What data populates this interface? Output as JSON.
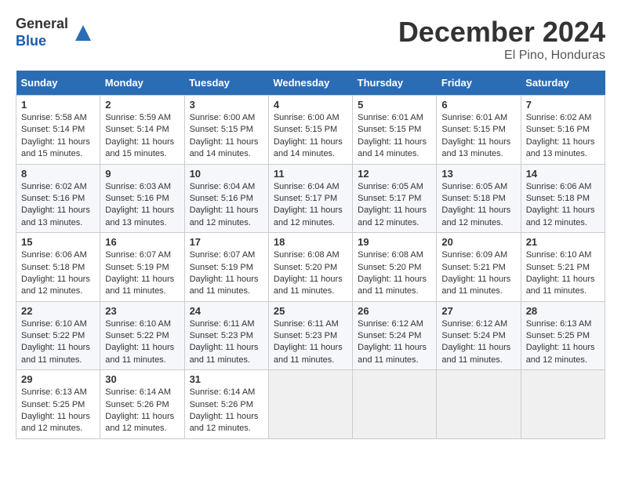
{
  "header": {
    "logo_line1": "General",
    "logo_line2": "Blue",
    "month_title": "December 2024",
    "location": "El Pino, Honduras"
  },
  "days_of_week": [
    "Sunday",
    "Monday",
    "Tuesday",
    "Wednesday",
    "Thursday",
    "Friday",
    "Saturday"
  ],
  "weeks": [
    [
      {
        "day": 1,
        "sunrise": "5:58 AM",
        "sunset": "5:14 PM",
        "daylight": "11 hours and 15 minutes."
      },
      {
        "day": 2,
        "sunrise": "5:59 AM",
        "sunset": "5:14 PM",
        "daylight": "11 hours and 15 minutes."
      },
      {
        "day": 3,
        "sunrise": "6:00 AM",
        "sunset": "5:15 PM",
        "daylight": "11 hours and 14 minutes."
      },
      {
        "day": 4,
        "sunrise": "6:00 AM",
        "sunset": "5:15 PM",
        "daylight": "11 hours and 14 minutes."
      },
      {
        "day": 5,
        "sunrise": "6:01 AM",
        "sunset": "5:15 PM",
        "daylight": "11 hours and 14 minutes."
      },
      {
        "day": 6,
        "sunrise": "6:01 AM",
        "sunset": "5:15 PM",
        "daylight": "11 hours and 13 minutes."
      },
      {
        "day": 7,
        "sunrise": "6:02 AM",
        "sunset": "5:16 PM",
        "daylight": "11 hours and 13 minutes."
      }
    ],
    [
      {
        "day": 8,
        "sunrise": "6:02 AM",
        "sunset": "5:16 PM",
        "daylight": "11 hours and 13 minutes."
      },
      {
        "day": 9,
        "sunrise": "6:03 AM",
        "sunset": "5:16 PM",
        "daylight": "11 hours and 13 minutes."
      },
      {
        "day": 10,
        "sunrise": "6:04 AM",
        "sunset": "5:16 PM",
        "daylight": "11 hours and 12 minutes."
      },
      {
        "day": 11,
        "sunrise": "6:04 AM",
        "sunset": "5:17 PM",
        "daylight": "11 hours and 12 minutes."
      },
      {
        "day": 12,
        "sunrise": "6:05 AM",
        "sunset": "5:17 PM",
        "daylight": "11 hours and 12 minutes."
      },
      {
        "day": 13,
        "sunrise": "6:05 AM",
        "sunset": "5:18 PM",
        "daylight": "11 hours and 12 minutes."
      },
      {
        "day": 14,
        "sunrise": "6:06 AM",
        "sunset": "5:18 PM",
        "daylight": "11 hours and 12 minutes."
      }
    ],
    [
      {
        "day": 15,
        "sunrise": "6:06 AM",
        "sunset": "5:18 PM",
        "daylight": "11 hours and 12 minutes."
      },
      {
        "day": 16,
        "sunrise": "6:07 AM",
        "sunset": "5:19 PM",
        "daylight": "11 hours and 11 minutes."
      },
      {
        "day": 17,
        "sunrise": "6:07 AM",
        "sunset": "5:19 PM",
        "daylight": "11 hours and 11 minutes."
      },
      {
        "day": 18,
        "sunrise": "6:08 AM",
        "sunset": "5:20 PM",
        "daylight": "11 hours and 11 minutes."
      },
      {
        "day": 19,
        "sunrise": "6:08 AM",
        "sunset": "5:20 PM",
        "daylight": "11 hours and 11 minutes."
      },
      {
        "day": 20,
        "sunrise": "6:09 AM",
        "sunset": "5:21 PM",
        "daylight": "11 hours and 11 minutes."
      },
      {
        "day": 21,
        "sunrise": "6:10 AM",
        "sunset": "5:21 PM",
        "daylight": "11 hours and 11 minutes."
      }
    ],
    [
      {
        "day": 22,
        "sunrise": "6:10 AM",
        "sunset": "5:22 PM",
        "daylight": "11 hours and 11 minutes."
      },
      {
        "day": 23,
        "sunrise": "6:10 AM",
        "sunset": "5:22 PM",
        "daylight": "11 hours and 11 minutes."
      },
      {
        "day": 24,
        "sunrise": "6:11 AM",
        "sunset": "5:23 PM",
        "daylight": "11 hours and 11 minutes."
      },
      {
        "day": 25,
        "sunrise": "6:11 AM",
        "sunset": "5:23 PM",
        "daylight": "11 hours and 11 minutes."
      },
      {
        "day": 26,
        "sunrise": "6:12 AM",
        "sunset": "5:24 PM",
        "daylight": "11 hours and 11 minutes."
      },
      {
        "day": 27,
        "sunrise": "6:12 AM",
        "sunset": "5:24 PM",
        "daylight": "11 hours and 11 minutes."
      },
      {
        "day": 28,
        "sunrise": "6:13 AM",
        "sunset": "5:25 PM",
        "daylight": "11 hours and 12 minutes."
      }
    ],
    [
      {
        "day": 29,
        "sunrise": "6:13 AM",
        "sunset": "5:25 PM",
        "daylight": "11 hours and 12 minutes."
      },
      {
        "day": 30,
        "sunrise": "6:14 AM",
        "sunset": "5:26 PM",
        "daylight": "11 hours and 12 minutes."
      },
      {
        "day": 31,
        "sunrise": "6:14 AM",
        "sunset": "5:26 PM",
        "daylight": "11 hours and 12 minutes."
      },
      null,
      null,
      null,
      null
    ]
  ]
}
